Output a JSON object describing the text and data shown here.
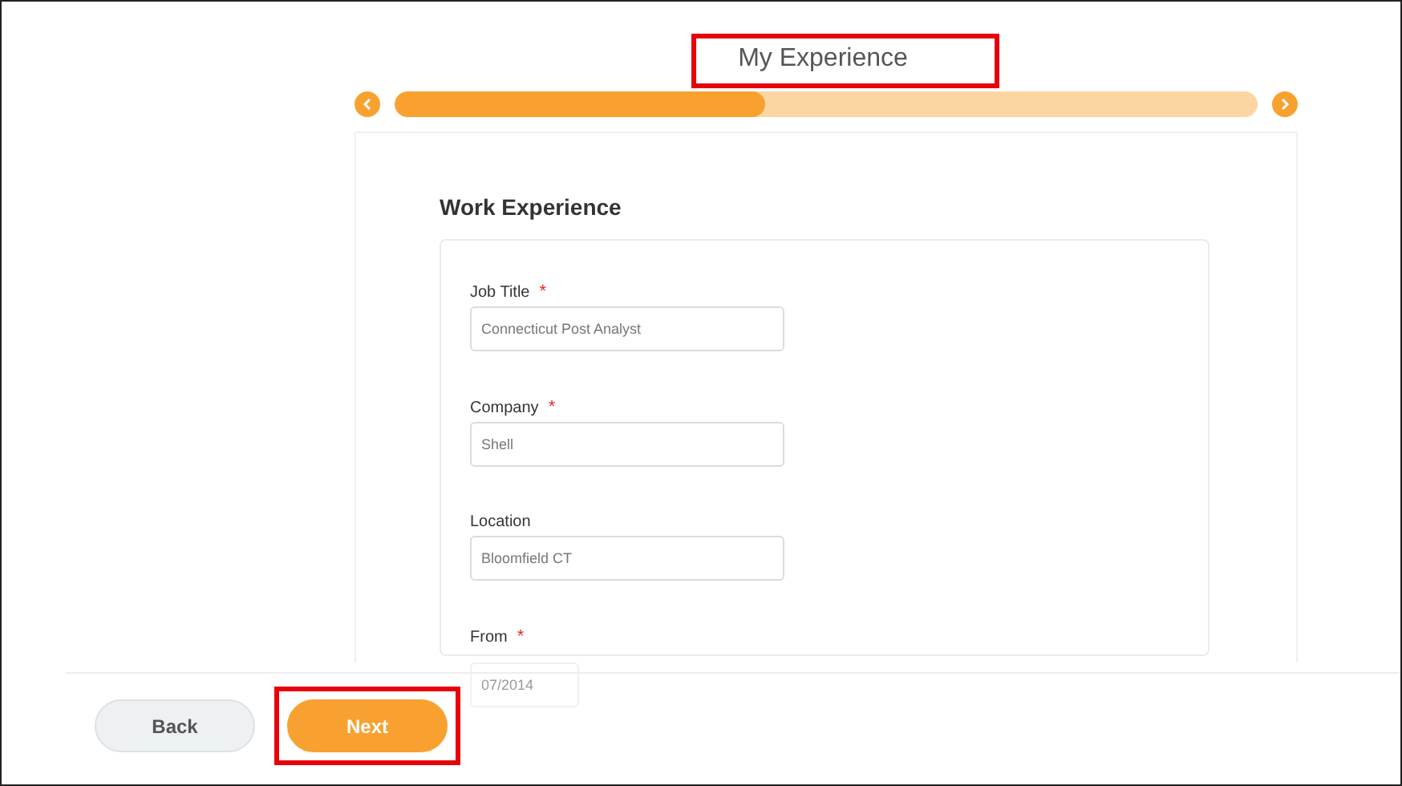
{
  "header": {
    "title": "My Experience",
    "highlighted": true
  },
  "progress": {
    "level": 0.43
  },
  "section": {
    "title": "Work Experience"
  },
  "fields": [
    {
      "label": "Job Title",
      "required": true,
      "kind": "text",
      "value": "Connecticut Post Analyst"
    },
    {
      "label": "Company",
      "required": true,
      "kind": "text",
      "value": "Shell"
    },
    {
      "label": "Location",
      "required": false,
      "kind": "text",
      "value": "Bloomfield CT"
    },
    {
      "label": "From",
      "required": true,
      "kind": "date",
      "value": "07/2014"
    }
  ],
  "required_mark": "*",
  "footer": {
    "buttons": [
      {
        "label": "Back",
        "kind": "secondary",
        "highlighted": false
      },
      {
        "label": "Next",
        "kind": "primary",
        "highlighted": true
      }
    ]
  }
}
